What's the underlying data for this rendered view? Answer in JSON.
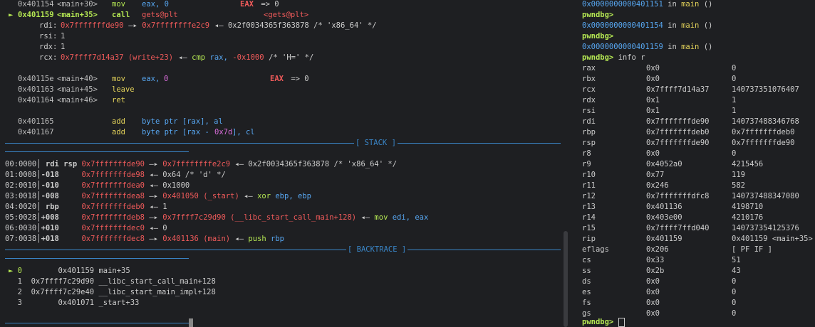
{
  "disasm": {
    "top": {
      "addr": "0x401154",
      "sym": "<main+30>",
      "op": "mov",
      "args": "eax, 0",
      "comment_reg": "EAX",
      "comment_rest": " => 0"
    },
    "current": {
      "marker": "►",
      "addr": "0x401159",
      "sym": "<main+35>",
      "op": "call",
      "args": "gets@plt",
      "target": "<gets@plt>"
    },
    "call_args": [
      {
        "reg": "rdi:",
        "v1": "0x7fffffffde90",
        "arrow1": " —▸ ",
        "v2": "0x7ffffffffe2c9",
        "arrow2": " ◂— ",
        "v3": "0x2f0034365f363878 /* 'x86_64' */"
      },
      {
        "reg": "rsi:",
        "v1": "1"
      },
      {
        "reg": "rdx:",
        "v1": "1"
      },
      {
        "reg": "rcx:",
        "v1": "0x7ffff7d14a37 (write+23)",
        "arrow1": " ◂— ",
        "v2": "cmp",
        "v3": " rax, ",
        "v4": "-0x1000",
        "v5": " /* 'H=' */"
      }
    ],
    "after": [
      {
        "addr": "0x40115e",
        "sym": "<main+40>",
        "op": "mov",
        "args": "eax, 0",
        "comment_reg": "EAX",
        "comment_rest": " => 0"
      },
      {
        "addr": "0x401163",
        "sym": "<main+45>",
        "op": "leave",
        "args": ""
      },
      {
        "addr": "0x401164",
        "sym": "<main+46>",
        "op": "ret",
        "args": ""
      },
      {
        "addr": "0x401165",
        "sym": "",
        "op": "add",
        "args": "byte ptr [rax], al"
      },
      {
        "addr": "0x401167",
        "sym": "",
        "op": "add",
        "args": "byte ptr [rax - 0x7d], cl"
      }
    ]
  },
  "stack_header": "[ STACK ]",
  "stack": [
    {
      "idx": "00:0000│",
      "regs": " rdi rsp ",
      "addr": "0x7fffffffde90",
      "rest": [
        {
          "t": " —▸ ",
          "c": "white"
        },
        {
          "t": "0x7ffffffffe2c9",
          "c": "red"
        },
        {
          "t": " ◂— 0x2f0034365f363878 /* 'x86_64' */",
          "c": "white"
        }
      ]
    },
    {
      "idx": "01:0008│",
      "regs": "-018     ",
      "addr": "0x7fffffffde98",
      "rest": [
        {
          "t": " ◂— 0x64 /* 'd' */",
          "c": "white"
        }
      ]
    },
    {
      "idx": "02:0010│",
      "regs": "-010     ",
      "addr": "0x7fffffffdea0",
      "rest": [
        {
          "t": " ◂— 0x1000",
          "c": "white"
        }
      ]
    },
    {
      "idx": "03:0018│",
      "regs": "-008     ",
      "addr": "0x7fffffffdea8",
      "rest": [
        {
          "t": " —▸ ",
          "c": "white"
        },
        {
          "t": "0x401050 (_start)",
          "c": "red"
        },
        {
          "t": " ◂— ",
          "c": "white"
        },
        {
          "t": "xor",
          "c": "green"
        },
        {
          "t": " ebp, ebp",
          "c": "blue"
        }
      ]
    },
    {
      "idx": "04:0020│",
      "regs": " rbp     ",
      "addr": "0x7fffffffdeb0",
      "rest": [
        {
          "t": " ◂— 1",
          "c": "white"
        }
      ]
    },
    {
      "idx": "05:0028│",
      "regs": "+008     ",
      "addr": "0x7fffffffdeb8",
      "rest": [
        {
          "t": " —▸ ",
          "c": "white"
        },
        {
          "t": "0x7ffff7c29d90 (__libc_start_call_main+128)",
          "c": "red"
        },
        {
          "t": " ◂— ",
          "c": "white"
        },
        {
          "t": "mov",
          "c": "green"
        },
        {
          "t": " edi, eax",
          "c": "blue"
        }
      ]
    },
    {
      "idx": "06:0030│",
      "regs": "+010     ",
      "addr": "0x7fffffffdec0",
      "rest": [
        {
          "t": " ◂— 0",
          "c": "white"
        }
      ]
    },
    {
      "idx": "07:0038│",
      "regs": "+018     ",
      "addr": "0x7fffffffdec8",
      "rest": [
        {
          "t": " —▸ ",
          "c": "white"
        },
        {
          "t": "0x401136 (main)",
          "c": "red"
        },
        {
          "t": " ◂— ",
          "c": "white"
        },
        {
          "t": "push",
          "c": "green"
        },
        {
          "t": " rbp",
          "c": "blue"
        }
      ]
    }
  ],
  "backtrace_header": "[ BACKTRACE ]",
  "backtrace": [
    {
      "marker": "► 0",
      "addr": "        0x401159",
      "sym": " main+35"
    },
    {
      "marker": "  1",
      "addr": "  0x7ffff7c29d90",
      "sym": " __libc_start_call_main+128"
    },
    {
      "marker": "  2",
      "addr": "  0x7ffff7c29e40",
      "sym": " __libc_start_main_impl+128"
    },
    {
      "marker": "  3",
      "addr": "        0x401071",
      "sym": " _start+33"
    }
  ],
  "right_history": [
    {
      "addr": "0x0000000000401151",
      "rest": " in main ()"
    },
    {
      "prompt": "pwndbg>"
    },
    {
      "addr": "0x0000000000401154",
      "rest": " in main ()"
    },
    {
      "prompt": "pwndbg>"
    },
    {
      "addr": "0x0000000000401159",
      "rest": " in main ()"
    },
    {
      "prompt": "pwndbg>",
      "cmd": " info r"
    }
  ],
  "registers": [
    {
      "name": "rax",
      "hex": "0x0",
      "val": "0"
    },
    {
      "name": "rbx",
      "hex": "0x0",
      "val": "0"
    },
    {
      "name": "rcx",
      "hex": "0x7ffff7d14a37",
      "val": "140737351076407"
    },
    {
      "name": "rdx",
      "hex": "0x1",
      "val": "1"
    },
    {
      "name": "rsi",
      "hex": "0x1",
      "val": "1"
    },
    {
      "name": "rdi",
      "hex": "0x7fffffffde90",
      "val": "140737488346768"
    },
    {
      "name": "rbp",
      "hex": "0x7fffffffdeb0",
      "val": "0x7fffffffdeb0"
    },
    {
      "name": "rsp",
      "hex": "0x7fffffffde90",
      "val": "0x7fffffffde90"
    },
    {
      "name": "r8",
      "hex": "0x0",
      "val": "0"
    },
    {
      "name": "r9",
      "hex": "0x4052a0",
      "val": "4215456"
    },
    {
      "name": "r10",
      "hex": "0x77",
      "val": "119"
    },
    {
      "name": "r11",
      "hex": "0x246",
      "val": "582"
    },
    {
      "name": "r12",
      "hex": "0x7fffffffdfc8",
      "val": "140737488347080"
    },
    {
      "name": "r13",
      "hex": "0x401136",
      "val": "4198710"
    },
    {
      "name": "r14",
      "hex": "0x403e00",
      "val": "4210176"
    },
    {
      "name": "r15",
      "hex": "0x7ffff7ffd040",
      "val": "140737354125376"
    },
    {
      "name": "rip",
      "hex": "0x401159",
      "val": "0x401159 <main+35>"
    },
    {
      "name": "eflags",
      "hex": "0x206",
      "val": "[ PF IF ]"
    },
    {
      "name": "cs",
      "hex": "0x33",
      "val": "51"
    },
    {
      "name": "ss",
      "hex": "0x2b",
      "val": "43"
    },
    {
      "name": "ds",
      "hex": "0x0",
      "val": "0"
    },
    {
      "name": "es",
      "hex": "0x0",
      "val": "0"
    },
    {
      "name": "fs",
      "hex": "0x0",
      "val": "0"
    },
    {
      "name": "gs",
      "hex": "0x0",
      "val": "0"
    }
  ],
  "final_prompt": "pwndbg>"
}
